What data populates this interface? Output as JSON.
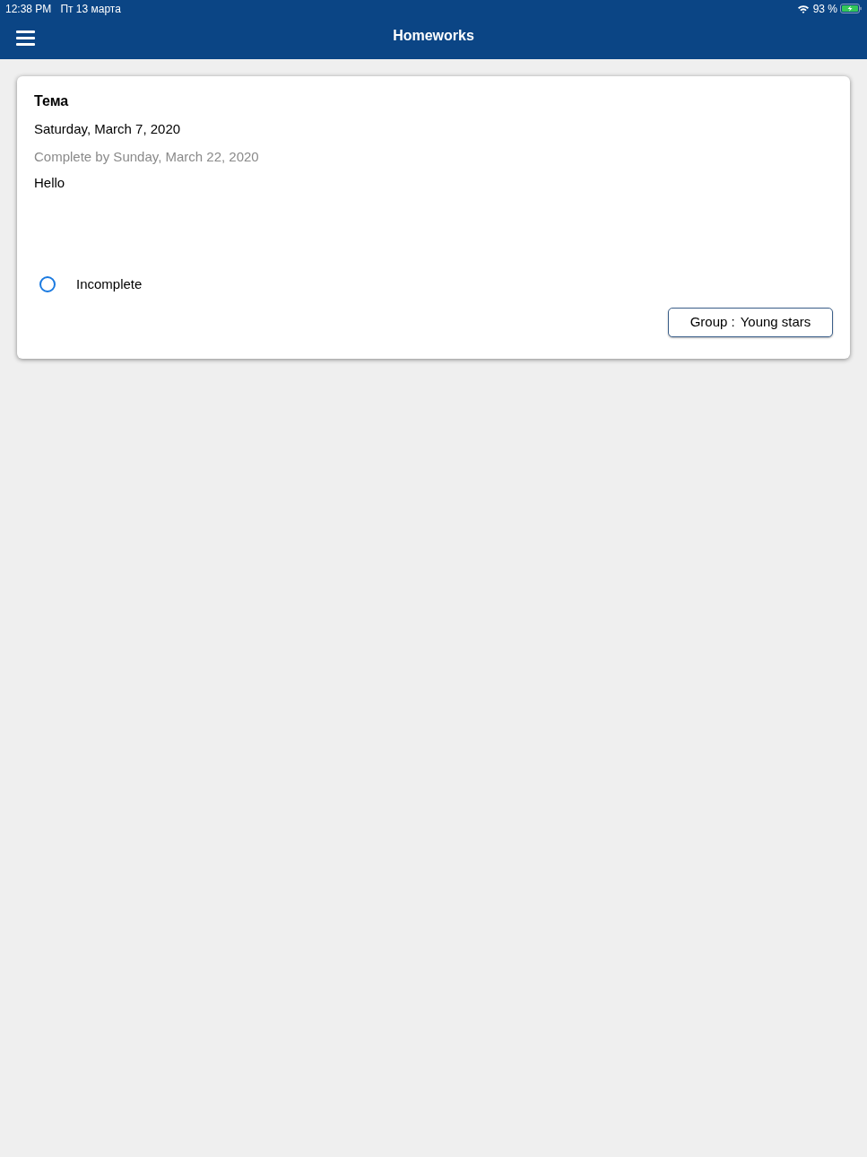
{
  "status_bar": {
    "time": "12:38 PM",
    "date": "Пт 13 марта",
    "battery": "93 %"
  },
  "nav_bar": {
    "title": "Homeworks"
  },
  "homework": {
    "topic": "Тема",
    "date": "Saturday, March 7, 2020",
    "due": "Complete by Sunday, March 22, 2020",
    "text": "Hello",
    "completed": false,
    "status": "Incomplete",
    "group": {
      "label": "Group :",
      "value": "Young stars"
    }
  }
}
